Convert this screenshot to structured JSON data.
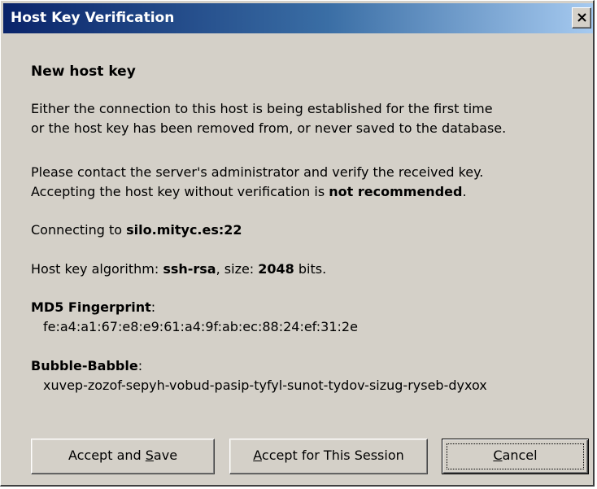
{
  "window": {
    "title": "Host Key Verification",
    "close_label": "Close"
  },
  "content": {
    "heading": "New host key",
    "para1_line1": "Either the connection to this host is being established for the first time",
    "para1_line2": "or the host key has been removed from, or never saved to the database.",
    "para2_line1": "Please contact the server's administrator and verify the received key.",
    "para2_line2_prefix": "Accepting the host key without verification is ",
    "para2_line2_bold": "not recommended",
    "para2_line2_suffix": ".",
    "connecting_prefix": "Connecting to ",
    "connecting_host": "silo.mityc.es",
    "connecting_port": ":22",
    "algo_prefix": "Host key algorithm: ",
    "algo_value": "ssh-rsa",
    "size_prefix": ", size: ",
    "size_value": "2048",
    "size_suffix": " bits.",
    "md5_label": "MD5 Fingerprint",
    "md5_colon": ":",
    "md5_value": "fe:a4:a1:67:e8:e9:61:a4:9f:ab:ec:88:24:ef:31:2e",
    "bubble_label": "Bubble-Babble",
    "bubble_colon": ":",
    "bubble_value": "xuvep-zozof-sepyh-vobud-pasip-tyfyl-sunot-tydov-sizug-ryseb-dyxox"
  },
  "buttons": {
    "accept_save_pre": "Accept and ",
    "accept_save_u": "S",
    "accept_save_post": "ave",
    "accept_session_u": "A",
    "accept_session_post": "ccept for This Session",
    "cancel_u": "C",
    "cancel_post": "ancel"
  }
}
